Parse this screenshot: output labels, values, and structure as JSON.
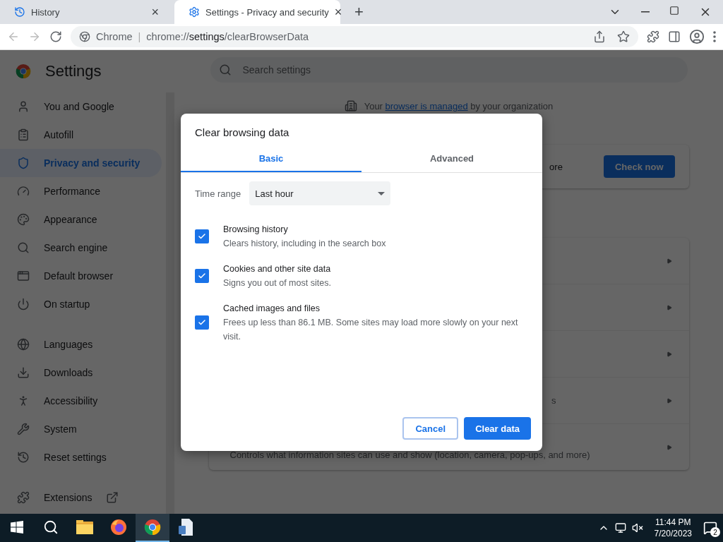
{
  "browser_tabs": [
    {
      "title": "History",
      "selected": false,
      "close": "×"
    },
    {
      "title": "Settings - Privacy and security",
      "selected": true,
      "close": "×"
    }
  ],
  "new_tab": "+",
  "address_bar": {
    "site": "Chrome",
    "separator": "|",
    "url_prefix": "chrome://",
    "url_host": "settings",
    "url_path": "/clearBrowserData"
  },
  "settings": {
    "title": "Settings",
    "search": {
      "placeholder": "Search settings"
    },
    "sidebar": {
      "items": [
        {
          "label": "You and Google",
          "selected": false
        },
        {
          "label": "Autofill",
          "selected": false
        },
        {
          "label": "Privacy and security",
          "selected": true
        },
        {
          "label": "Performance",
          "selected": false
        },
        {
          "label": "Appearance",
          "selected": false
        },
        {
          "label": "Search engine",
          "selected": false
        },
        {
          "label": "Default browser",
          "selected": false
        },
        {
          "label": "On startup",
          "selected": false
        },
        {
          "label": "Languages",
          "selected": false
        },
        {
          "label": "Downloads",
          "selected": false
        },
        {
          "label": "Accessibility",
          "selected": false
        },
        {
          "label": "System",
          "selected": false
        },
        {
          "label": "Reset settings",
          "selected": false
        }
      ],
      "extensions": "Extensions"
    },
    "managed_notice": {
      "before": "Your ",
      "link": "browser is managed",
      "after": " by your organization"
    },
    "safety_card": {
      "text": "ore",
      "button": "Check now"
    },
    "privacy_rows": [
      {
        "kind": "hidden"
      },
      {
        "kind": "hidden"
      },
      {
        "kind": "hidden"
      },
      {
        "kind": "tail",
        "text": "s"
      },
      {
        "kind": "full",
        "text": "Controls what information sites can use and show (location, camera, pop-ups, and more)"
      }
    ]
  },
  "dialog": {
    "title": "Clear browsing data",
    "tabs": [
      {
        "label": "Basic",
        "selected": true
      },
      {
        "label": "Advanced",
        "selected": false
      }
    ],
    "time_range": {
      "label": "Time range",
      "value": "Last hour"
    },
    "options": [
      {
        "title": "Browsing history",
        "description": "Clears history, including in the search box",
        "checked": true
      },
      {
        "title": "Cookies and other site data",
        "description": "Signs you out of most sites.",
        "checked": true
      },
      {
        "title": "Cached images and files",
        "description": "Frees up less than 86.1 MB. Some sites may load more slowly on your next visit.",
        "checked": true
      }
    ],
    "buttons": [
      {
        "label": "Cancel",
        "kind": "secondary"
      },
      {
        "label": "Clear data",
        "kind": "primary"
      }
    ]
  },
  "taskbar": {
    "apps": [
      {
        "selected": false
      },
      {
        "selected": false
      },
      {
        "selected": true
      },
      {
        "selected": false
      }
    ],
    "time": "11:44 PM",
    "date": "7/20/2023",
    "notifications": "2"
  }
}
